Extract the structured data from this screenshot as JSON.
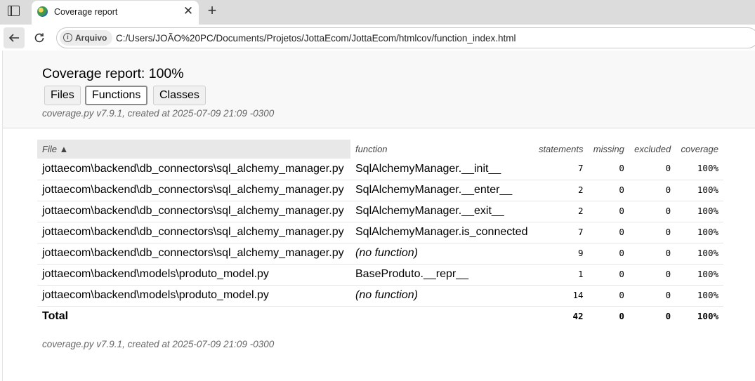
{
  "browser": {
    "tab_title": "Coverage report",
    "site_chip": "Arquivo",
    "url": "C:/Users/JOÃO%20PC/Documents/Projetos/JottaEcom/JottaEcom/htmlcov/function_index.html"
  },
  "page": {
    "title": "Coverage report: 100%",
    "nav": [
      "Files",
      "Functions",
      "Classes"
    ],
    "current_nav": "Functions",
    "meta": "coverage.py v7.9.1, created at 2025-07-09 21:09 -0300"
  },
  "table": {
    "headers": {
      "file": "File ▲",
      "function": "function",
      "statements": "statements",
      "missing": "missing",
      "excluded": "excluded",
      "coverage": "coverage"
    },
    "rows": [
      {
        "file": "jottaecom\\backend\\db_connectors\\sql_alchemy_manager.py",
        "function": "SqlAlchemyManager.__init__",
        "statements": "7",
        "missing": "0",
        "excluded": "0",
        "coverage": "100%"
      },
      {
        "file": "jottaecom\\backend\\db_connectors\\sql_alchemy_manager.py",
        "function": "SqlAlchemyManager.__enter__",
        "statements": "2",
        "missing": "0",
        "excluded": "0",
        "coverage": "100%"
      },
      {
        "file": "jottaecom\\backend\\db_connectors\\sql_alchemy_manager.py",
        "function": "SqlAlchemyManager.__exit__",
        "statements": "2",
        "missing": "0",
        "excluded": "0",
        "coverage": "100%"
      },
      {
        "file": "jottaecom\\backend\\db_connectors\\sql_alchemy_manager.py",
        "function": "SqlAlchemyManager.is_connected",
        "statements": "7",
        "missing": "0",
        "excluded": "0",
        "coverage": "100%"
      },
      {
        "file": "jottaecom\\backend\\db_connectors\\sql_alchemy_manager.py",
        "function": "(no function)",
        "statements": "9",
        "missing": "0",
        "excluded": "0",
        "coverage": "100%"
      },
      {
        "file": "jottaecom\\backend\\models\\produto_model.py",
        "function": "BaseProduto.__repr__",
        "statements": "1",
        "missing": "0",
        "excluded": "0",
        "coverage": "100%"
      },
      {
        "file": "jottaecom\\backend\\models\\produto_model.py",
        "function": "(no function)",
        "statements": "14",
        "missing": "0",
        "excluded": "0",
        "coverage": "100%"
      }
    ],
    "total": {
      "label": "Total",
      "statements": "42",
      "missing": "0",
      "excluded": "0",
      "coverage": "100%"
    }
  }
}
